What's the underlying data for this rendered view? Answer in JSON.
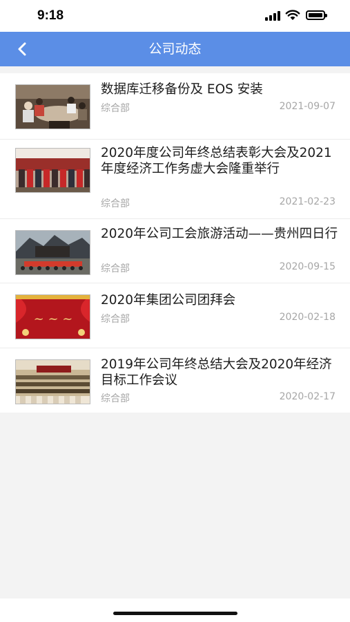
{
  "status_bar": {
    "time": "9:18"
  },
  "nav": {
    "title": "公司动态",
    "back_icon": "chevron-left-icon"
  },
  "news": [
    {
      "title": "数据库迁移备份及 EOS 安装",
      "department": "综合部",
      "date": "2021-09-07",
      "thumbnail": "meeting-room-photo"
    },
    {
      "title": "2020年度公司年终总结表彰大会及2021年度经济工作务虚大会隆重举行",
      "department": "综合部",
      "date": "2021-02-23",
      "thumbnail": "award-ceremony-photo"
    },
    {
      "title": "2020年公司工会旅游活动——贵州四日行",
      "department": "综合部",
      "date": "2020-09-15",
      "thumbnail": "group-travel-photo"
    },
    {
      "title": "2020年集团公司团拜会",
      "department": "综合部",
      "date": "2020-02-18",
      "thumbnail": "red-new-year-banner"
    },
    {
      "title": "2019年公司年终总结大会及2020年经济目标工作会议",
      "department": "综合部",
      "date": "2020-02-17",
      "thumbnail": "conference-hall-photo"
    }
  ],
  "colors": {
    "nav_bg": "#5b8ee6",
    "meta_text": "#a6a6a6"
  }
}
